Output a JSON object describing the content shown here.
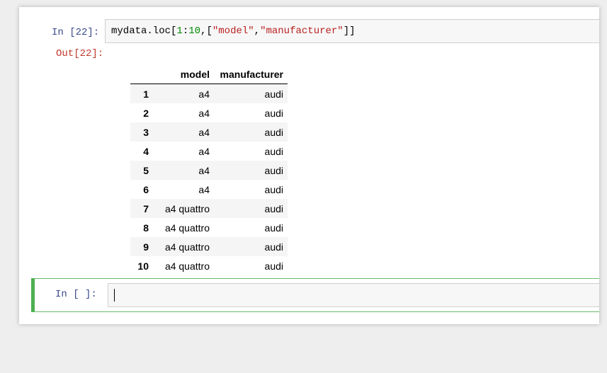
{
  "cells": [
    {
      "prompt": "In  [22]:",
      "code": {
        "prefix": "mydata.loc[",
        "num1": "1",
        "colon": ":",
        "num2": "10",
        "mid": ",[",
        "str1": "\"model\"",
        "comma": ",",
        "str2": "\"manufacturer\"",
        "suffix": "]]"
      },
      "output_prompt": "Out[22]:",
      "table": {
        "columns": [
          "",
          "model",
          "manufacturer"
        ],
        "rows": [
          {
            "index": "1",
            "model": "a4",
            "manufacturer": "audi"
          },
          {
            "index": "2",
            "model": "a4",
            "manufacturer": "audi"
          },
          {
            "index": "3",
            "model": "a4",
            "manufacturer": "audi"
          },
          {
            "index": "4",
            "model": "a4",
            "manufacturer": "audi"
          },
          {
            "index": "5",
            "model": "a4",
            "manufacturer": "audi"
          },
          {
            "index": "6",
            "model": "a4",
            "manufacturer": "audi"
          },
          {
            "index": "7",
            "model": "a4 quattro",
            "manufacturer": "audi"
          },
          {
            "index": "8",
            "model": "a4 quattro",
            "manufacturer": "audi"
          },
          {
            "index": "9",
            "model": "a4 quattro",
            "manufacturer": "audi"
          },
          {
            "index": "10",
            "model": "a4 quattro",
            "manufacturer": "audi"
          }
        ]
      }
    },
    {
      "prompt": "In  [ ]:",
      "code": ""
    }
  ],
  "colors": {
    "selected_cell_border": "#4caf50",
    "string_token": "#ba2121",
    "number_token": "#008800",
    "output_prompt": "#c0392b"
  }
}
